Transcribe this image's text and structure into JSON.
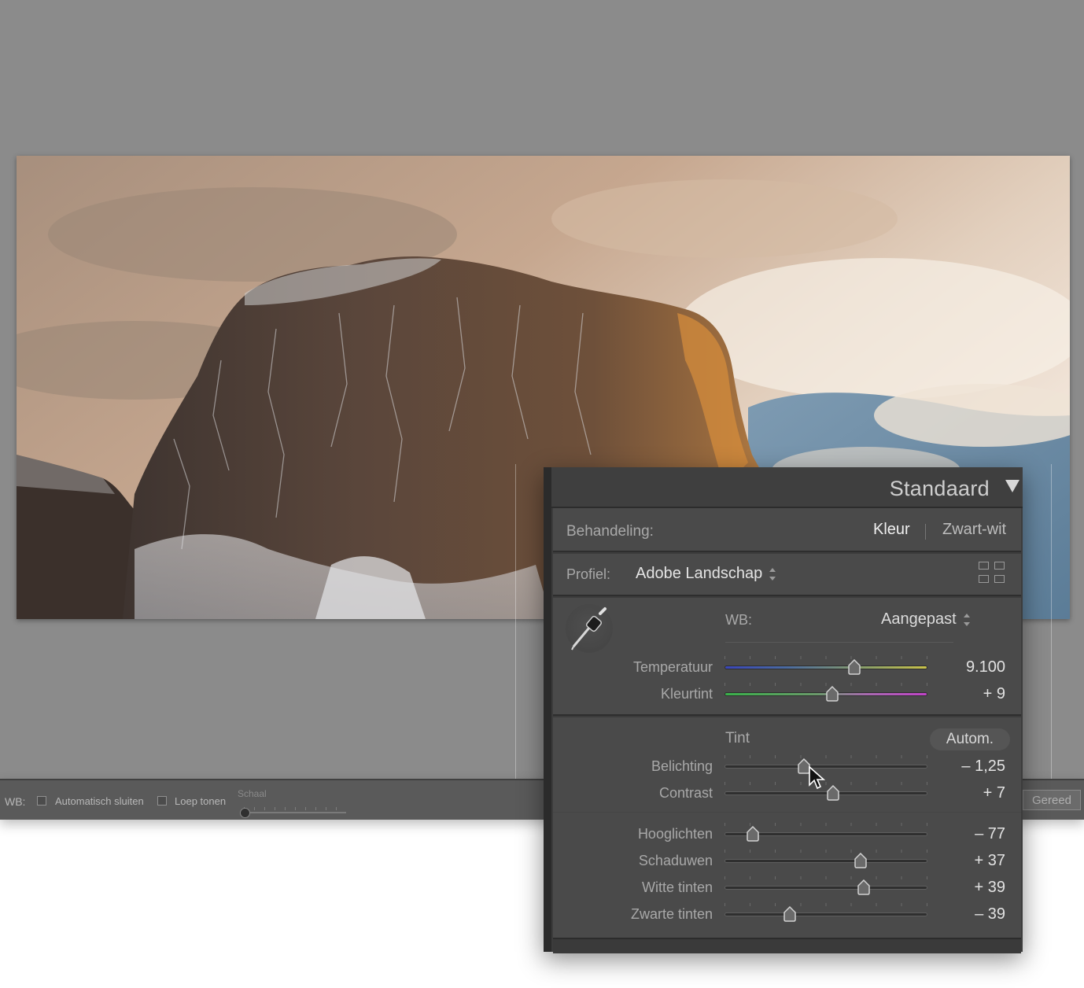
{
  "toolbar": {
    "wb_label": "WB:",
    "auto_close_label": "Automatisch sluiten",
    "show_loupe_label": "Loep tonen",
    "scale_label": "Schaal",
    "done_label": "Gereed"
  },
  "panel": {
    "title": "Standaard",
    "treatment": {
      "label": "Behandeling:",
      "option_color": "Kleur",
      "option_bw": "Zwart-wit"
    },
    "profile": {
      "label": "Profiel:",
      "value": "Adobe Landschap"
    },
    "wb": {
      "label": "WB:",
      "value": "Aangepast"
    },
    "tone": {
      "label": "Tint",
      "auto_label": "Autom."
    },
    "sliders": [
      {
        "label": "Temperatuur",
        "value": "9.100",
        "position": 0.64
      },
      {
        "label": "Kleurtint",
        "value": "+ 9",
        "position": 0.53
      },
      {
        "label": "Belichting",
        "value": "– 1,25",
        "position": 0.39
      },
      {
        "label": "Contrast",
        "value": "+ 7",
        "position": 0.535
      },
      {
        "label": "Hooglichten",
        "value": "– 77",
        "position": 0.14
      },
      {
        "label": "Schaduwen",
        "value": "+ 37",
        "position": 0.67
      },
      {
        "label": "Witte tinten",
        "value": "+ 39",
        "position": 0.685
      },
      {
        "label": "Zwarte tinten",
        "value": "– 39",
        "position": 0.32
      }
    ]
  },
  "colors": {
    "panel_bg": "#4a4a4a",
    "app_bg": "#8b8b8b",
    "toolbar_bg": "#5a5a5a"
  }
}
